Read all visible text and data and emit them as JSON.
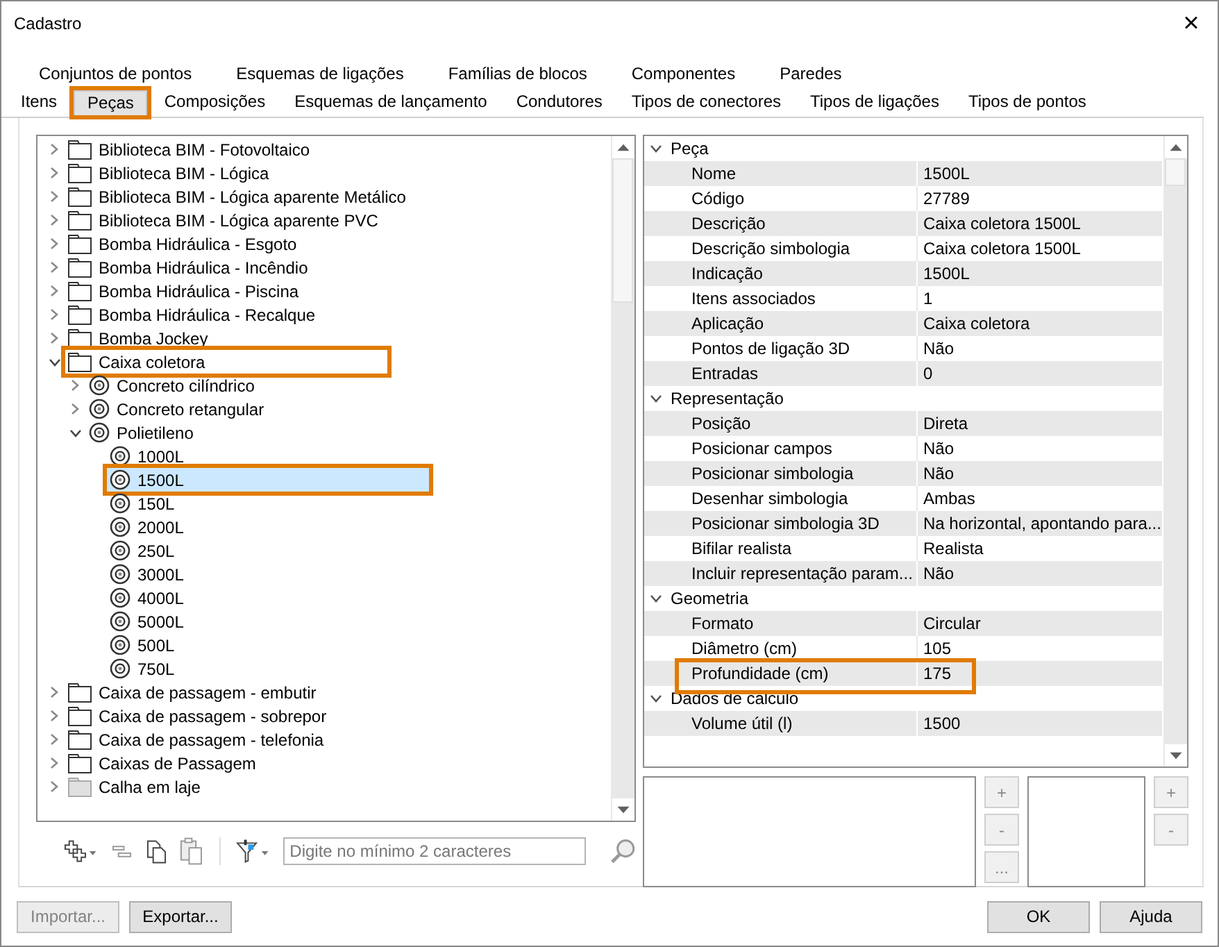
{
  "window": {
    "title": "Cadastro",
    "close": "×"
  },
  "tab_rows": [
    {
      "tabs": [
        {
          "label": "Conjuntos de pontos",
          "selected": false,
          "highlighted": false
        },
        {
          "label": "Esquemas de ligações",
          "selected": false,
          "highlighted": false
        },
        {
          "label": "Famílias de blocos",
          "selected": false,
          "highlighted": false
        },
        {
          "label": "Componentes",
          "selected": false,
          "highlighted": false
        },
        {
          "label": "Paredes",
          "selected": false,
          "highlighted": false
        }
      ]
    },
    {
      "tabs": [
        {
          "label": "Itens",
          "selected": false,
          "highlighted": false
        },
        {
          "label": "Peças",
          "selected": true,
          "highlighted": true
        },
        {
          "label": "Composições",
          "selected": false,
          "highlighted": false
        },
        {
          "label": "Esquemas de lançamento",
          "selected": false,
          "highlighted": false
        },
        {
          "label": "Condutores",
          "selected": false,
          "highlighted": false
        },
        {
          "label": "Tipos de conectores",
          "selected": false,
          "highlighted": false
        },
        {
          "label": "Tipos de ligações",
          "selected": false,
          "highlighted": false
        },
        {
          "label": "Tipos de pontos",
          "selected": false,
          "highlighted": false
        }
      ]
    }
  ],
  "tree": [
    {
      "name": "Biblioteca BIM - Fotovoltaico",
      "kind": "folder",
      "expanded": false,
      "disabled": false,
      "selected": false,
      "highlighted": false
    },
    {
      "name": "Biblioteca BIM - Lógica",
      "kind": "folder",
      "expanded": false,
      "disabled": false,
      "selected": false,
      "highlighted": false
    },
    {
      "name": "Biblioteca BIM - Lógica aparente Metálico",
      "kind": "folder",
      "expanded": false,
      "disabled": false,
      "selected": false,
      "highlighted": false
    },
    {
      "name": "Biblioteca BIM - Lógica aparente PVC",
      "kind": "folder",
      "expanded": false,
      "disabled": false,
      "selected": false,
      "highlighted": false
    },
    {
      "name": "Bomba Hidráulica - Esgoto",
      "kind": "folder",
      "expanded": false,
      "disabled": false,
      "selected": false,
      "highlighted": false
    },
    {
      "name": "Bomba Hidráulica - Incêndio",
      "kind": "folder",
      "expanded": false,
      "disabled": false,
      "selected": false,
      "highlighted": false
    },
    {
      "name": "Bomba Hidráulica - Piscina",
      "kind": "folder",
      "expanded": false,
      "disabled": false,
      "selected": false,
      "highlighted": false
    },
    {
      "name": "Bomba Hidráulica - Recalque",
      "kind": "folder",
      "expanded": false,
      "disabled": false,
      "selected": false,
      "highlighted": false
    },
    {
      "name": "Bomba Jockey",
      "kind": "folder",
      "expanded": false,
      "disabled": false,
      "selected": false,
      "highlighted": false
    },
    {
      "name": "Caixa coletora",
      "kind": "folder",
      "expanded": true,
      "disabled": false,
      "selected": false,
      "highlighted": true,
      "children": [
        {
          "name": "Concreto cilíndrico",
          "kind": "group",
          "expanded": false,
          "disabled": false,
          "selected": false,
          "highlighted": false
        },
        {
          "name": "Concreto retangular",
          "kind": "group",
          "expanded": false,
          "disabled": false,
          "selected": false,
          "highlighted": false
        },
        {
          "name": "Polietileno",
          "kind": "group",
          "expanded": true,
          "disabled": false,
          "selected": false,
          "highlighted": false,
          "children": [
            {
              "name": "1000L",
              "kind": "part",
              "disabled": false,
              "selected": false,
              "highlighted": false
            },
            {
              "name": "1500L",
              "kind": "part",
              "disabled": false,
              "selected": true,
              "highlighted": true
            },
            {
              "name": "150L",
              "kind": "part",
              "disabled": false,
              "selected": false,
              "highlighted": false
            },
            {
              "name": "2000L",
              "kind": "part",
              "disabled": false,
              "selected": false,
              "highlighted": false
            },
            {
              "name": "250L",
              "kind": "part",
              "disabled": false,
              "selected": false,
              "highlighted": false
            },
            {
              "name": "3000L",
              "kind": "part",
              "disabled": false,
              "selected": false,
              "highlighted": false
            },
            {
              "name": "4000L",
              "kind": "part",
              "disabled": false,
              "selected": false,
              "highlighted": false
            },
            {
              "name": "5000L",
              "kind": "part",
              "disabled": false,
              "selected": false,
              "highlighted": false
            },
            {
              "name": "500L",
              "kind": "part",
              "disabled": false,
              "selected": false,
              "highlighted": false
            },
            {
              "name": "750L",
              "kind": "part",
              "disabled": false,
              "selected": false,
              "highlighted": false
            }
          ]
        }
      ]
    },
    {
      "name": "Caixa de passagem - embutir",
      "kind": "folder",
      "expanded": false,
      "disabled": false,
      "selected": false,
      "highlighted": false
    },
    {
      "name": "Caixa de passagem - sobrepor",
      "kind": "folder",
      "expanded": false,
      "disabled": false,
      "selected": false,
      "highlighted": false
    },
    {
      "name": "Caixa de passagem - telefonia",
      "kind": "folder",
      "expanded": false,
      "disabled": false,
      "selected": false,
      "highlighted": false
    },
    {
      "name": "Caixas de Passagem",
      "kind": "folder",
      "expanded": false,
      "disabled": false,
      "selected": false,
      "highlighted": false
    },
    {
      "name": "Calha em laje",
      "kind": "folder",
      "expanded": false,
      "disabled": true,
      "selected": false,
      "highlighted": false
    }
  ],
  "search": {
    "placeholder": "Digite no mínimo 2 caracteres"
  },
  "properties": [
    {
      "name": "Peça",
      "expanded": true,
      "rows": [
        {
          "name": "Nome",
          "value": "1500L",
          "highlighted": false
        },
        {
          "name": "Código",
          "value": "27789",
          "highlighted": false
        },
        {
          "name": "Descrição",
          "value": "Caixa coletora 1500L",
          "highlighted": false
        },
        {
          "name": "Descrição simbologia",
          "value": "Caixa coletora 1500L",
          "highlighted": false
        },
        {
          "name": "Indicação",
          "value": "1500L",
          "highlighted": false
        },
        {
          "name": "Itens associados",
          "value": "1",
          "highlighted": false
        },
        {
          "name": "Aplicação",
          "value": "Caixa coletora",
          "highlighted": false
        },
        {
          "name": "Pontos de ligação 3D",
          "value": "Não",
          "highlighted": false
        },
        {
          "name": "Entradas",
          "value": "0",
          "highlighted": false
        }
      ]
    },
    {
      "name": "Representação",
      "expanded": true,
      "rows": [
        {
          "name": "Posição",
          "value": "Direta",
          "highlighted": false
        },
        {
          "name": "Posicionar campos",
          "value": "Não",
          "highlighted": false
        },
        {
          "name": "Posicionar simbologia",
          "value": "Não",
          "highlighted": false
        },
        {
          "name": "Desenhar simbologia",
          "value": "Ambas",
          "highlighted": false
        },
        {
          "name": "Posicionar simbologia 3D",
          "value": "Na horizontal, apontando para...",
          "highlighted": false
        },
        {
          "name": "Bifilar realista",
          "value": "Realista",
          "highlighted": false
        },
        {
          "name": "Incluir representação param...",
          "value": "Não",
          "highlighted": false
        }
      ]
    },
    {
      "name": "Geometria",
      "expanded": true,
      "rows": [
        {
          "name": "Formato",
          "value": "Circular",
          "highlighted": false
        },
        {
          "name": "Diâmetro (cm)",
          "value": "105",
          "highlighted": false
        },
        {
          "name": "Profundidade (cm)",
          "value": "175",
          "highlighted": true
        }
      ]
    },
    {
      "name": "Dados de cálculo",
      "expanded": true,
      "rows": [
        {
          "name": "Volume útil (l)",
          "value": "1500",
          "highlighted": false
        }
      ]
    }
  ],
  "list_buttons_left": [
    "+",
    "-",
    "..."
  ],
  "list_buttons_right": [
    "+",
    "-"
  ],
  "footer_left": [
    {
      "label": "Importar...",
      "disabled": true
    },
    {
      "label": "Exportar...",
      "disabled": false
    }
  ],
  "footer_right": [
    {
      "label": "OK",
      "disabled": false
    },
    {
      "label": "Ajuda",
      "disabled": false
    }
  ]
}
